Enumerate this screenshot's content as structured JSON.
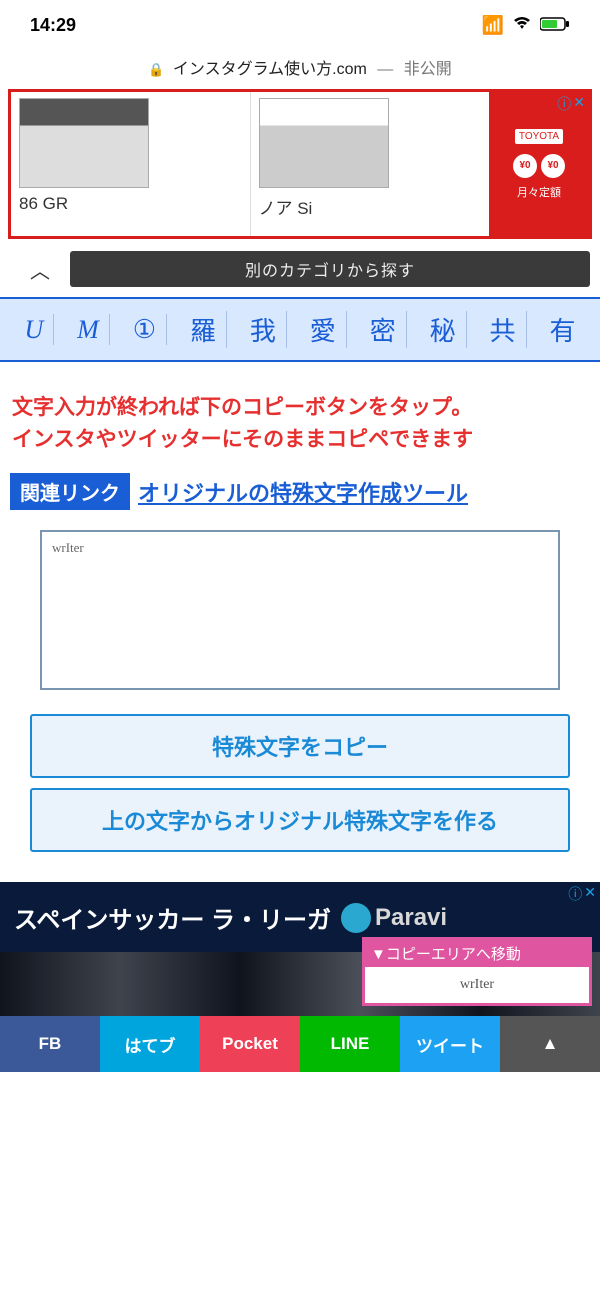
{
  "status": {
    "time": "14:29"
  },
  "urlbar": {
    "domain": "インスタグラム使い方.com",
    "privacy": "非公開"
  },
  "ad_top": {
    "cars": [
      {
        "label": "86 GR"
      },
      {
        "label": "ノア Si"
      }
    ],
    "brand": "TOYOTA",
    "circles": [
      "¥0",
      "¥0"
    ],
    "month": "月々定額"
  },
  "chevron_bar": {
    "dark_text": "別のカテゴリから探す"
  },
  "char_strip": [
    "U",
    "M",
    "①",
    "羅",
    "我",
    "愛",
    "密",
    "秘",
    "共",
    "有"
  ],
  "instructions": {
    "line1": "文字入力が終われば下のコピーボタンをタップ。",
    "line2": "インスタやツイッターにそのままコピペできます"
  },
  "related": {
    "label": "関連リンク",
    "link": "オリジナルの特殊文字作成ツール"
  },
  "textarea": {
    "value": "wrIter"
  },
  "buttons": {
    "copy": "特殊文字をコピー",
    "create": "上の文字からオリジナル特殊文字を作る"
  },
  "ad_bottom": {
    "headline": "スペインサッカー ラ・リーガ",
    "brand": "Paravi"
  },
  "pink_box": {
    "head": "▼コピーエリアへ移動",
    "body": "wrIter"
  },
  "share": {
    "fb": "FB",
    "hb": "はてブ",
    "pk": "Pocket",
    "ln": "LINE",
    "tw": "ツイート",
    "up": "▲"
  },
  "ad_badge": {
    "info": "ⓘ",
    "close": "✕"
  }
}
